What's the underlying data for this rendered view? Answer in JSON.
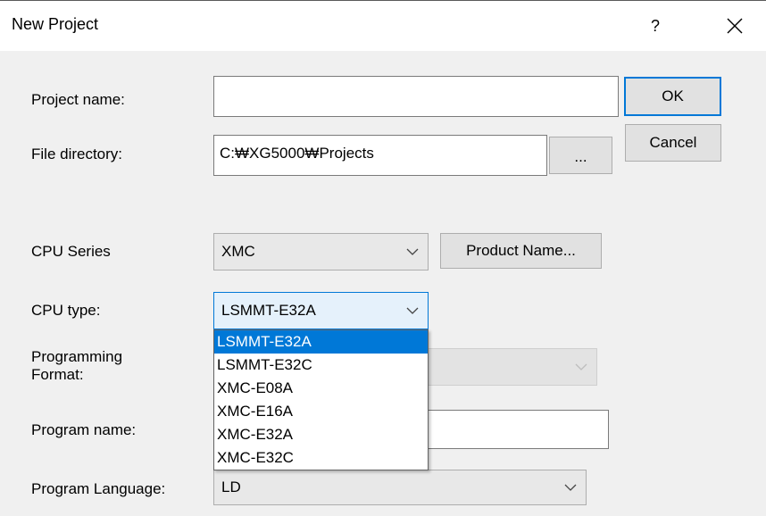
{
  "window": {
    "title": "New Project",
    "help_label": "?",
    "close_icon": "close-icon"
  },
  "form": {
    "project_name_label": "Project name:",
    "project_name_value": "",
    "file_directory_label": "File directory:",
    "file_directory_value": "C:₩XG5000₩Projects",
    "browse_label": "...",
    "cpu_series_label": "CPU Series",
    "cpu_series_value": "XMC",
    "product_name_label": "Product Name...",
    "cpu_type_label": "CPU type:",
    "cpu_type_value": "LSMMT-E32A",
    "programming_format_label": "Programming Format:",
    "programming_format_value": "",
    "program_name_label": "Program name:",
    "program_name_value": "",
    "program_language_label": "Program Language:",
    "program_language_value": "LD"
  },
  "buttons": {
    "ok_label": "OK",
    "cancel_label": "Cancel"
  },
  "cpu_type_dropdown": {
    "options": [
      "LSMMT-E32A",
      "LSMMT-E32C",
      "XMC-E08A",
      "XMC-E16A",
      "XMC-E32A",
      "XMC-E32C"
    ],
    "selected": "LSMMT-E32A"
  },
  "colors": {
    "accent": "#0078d7",
    "dialog_bg": "#f0f0f0"
  }
}
